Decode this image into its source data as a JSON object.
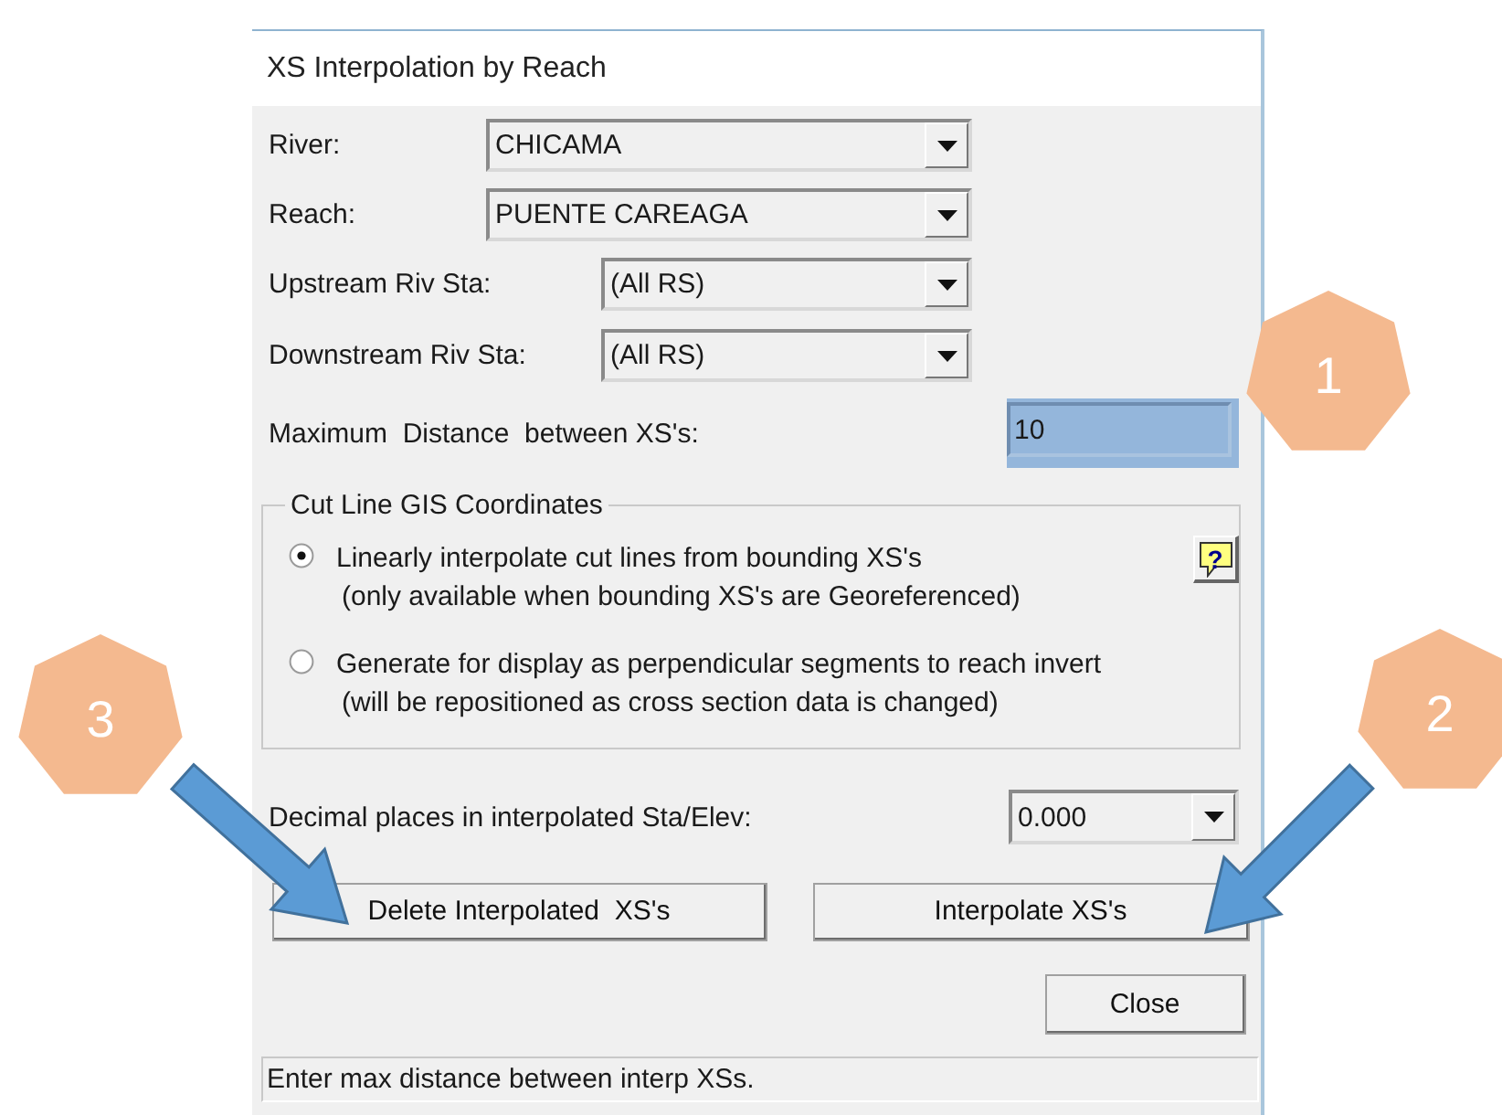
{
  "window": {
    "title": "XS Interpolation by Reach"
  },
  "selectors": [
    {
      "label": "River:",
      "value": "CHICAMA"
    },
    {
      "label": "Reach:",
      "value": "PUENTE CAREAGA"
    },
    {
      "label": "Upstream Riv Sta:",
      "value": "(All RS)"
    },
    {
      "label": "Downstream Riv Sta:",
      "value": "(All RS)"
    }
  ],
  "max_distance": {
    "label": "Maximum  Distance  between XS's:",
    "value": "10",
    "focused": true
  },
  "cut_line_group": {
    "title": "Cut Line GIS Coordinates",
    "help_button": "?",
    "options": [
      {
        "text": "Linearly interpolate cut lines from bounding XS's",
        "note": "(only available when bounding XS's are Georeferenced)",
        "selected": true
      },
      {
        "text": "Generate for display as perpendicular segments to reach invert",
        "note": "(will be repositioned as cross section data is changed)",
        "selected": false
      }
    ]
  },
  "decimal_places": {
    "label": "Decimal places in interpolated Sta/Elev:",
    "value": "0.000"
  },
  "buttons": [
    {
      "label": "Delete Interpolated  XS's"
    },
    {
      "label": "Interpolate XS's"
    }
  ],
  "close_button": {
    "label": "Close"
  },
  "status_bar": "Enter max distance between interp XSs.",
  "callouts": [
    {
      "label": "1"
    },
    {
      "label": "2"
    },
    {
      "label": "3"
    }
  ]
}
